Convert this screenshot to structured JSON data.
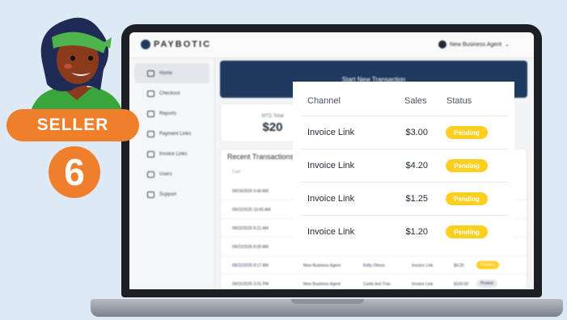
{
  "app": {
    "brand": "PAYBOTIC",
    "agent_label": "New Business Agent",
    "banner_text": "Start New Transaction",
    "mtd_label": "MTD Total",
    "mtd_value": "$20",
    "recent_title": "Recent Transactions",
    "date_header": "Date",
    "nav": [
      {
        "label": "Home"
      },
      {
        "label": "Checkout"
      },
      {
        "label": "Reports"
      },
      {
        "label": "Payment Links"
      },
      {
        "label": "Invoice Links"
      },
      {
        "label": "Users"
      },
      {
        "label": "Support"
      }
    ],
    "recent_rows": [
      {
        "date": "09/24/2025 9:40 AM"
      },
      {
        "date": "09/22/2025 10:45 AM"
      },
      {
        "date": "09/22/2025 8:21 AM"
      },
      {
        "date": "09/22/2025 8:00 AM"
      },
      {
        "date": "09/22/2025 8:17 AM",
        "agent": "New Business Agent",
        "customer": "Kelly Ohess",
        "channel": "Invoice Link",
        "amount": "$4.20",
        "status": "Pending"
      },
      {
        "date": "09/15/2025 3:01 PM",
        "agent": "New Business Agent",
        "customer": "Curtis test Tran",
        "channel": "Invoice Link",
        "amount": "$100.00",
        "status": "Posted"
      }
    ]
  },
  "card": {
    "headers": {
      "channel": "Channel",
      "sales": "Sales",
      "status": "Status"
    },
    "rows": [
      {
        "channel": "Invoice Link",
        "sales": "$3.00",
        "status": "Pending"
      },
      {
        "channel": "Invoice Link",
        "sales": "$4.20",
        "status": "Pending"
      },
      {
        "channel": "Invoice Link",
        "sales": "$1.25",
        "status": "Pending"
      },
      {
        "channel": "Invoice Link",
        "sales": "$1.20",
        "status": "Pending"
      }
    ]
  },
  "badge": {
    "label": "SELLER",
    "number": "6"
  },
  "colors": {
    "brand_navy": "#1f3a5f",
    "pending_yellow": "#ffcf1f",
    "seller_orange": "#f07f2b",
    "background": "#dde9f4"
  }
}
